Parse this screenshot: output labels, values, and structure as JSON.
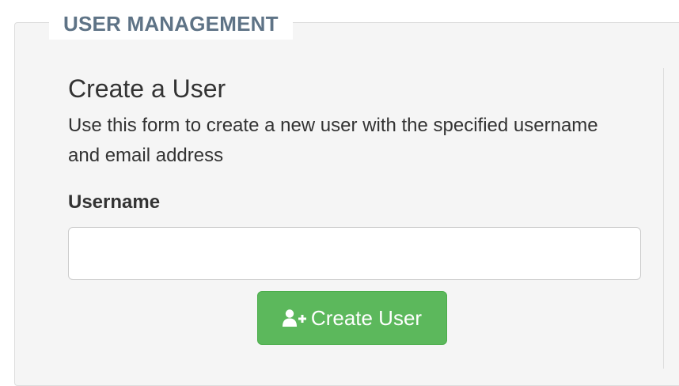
{
  "section": {
    "legend": "USER MANAGEMENT"
  },
  "form": {
    "title": "Create a User",
    "description": "Use this form to create a new user with the specified username and email address",
    "username_label": "Username",
    "username_value": "",
    "username_placeholder": "",
    "submit_label": "Create User",
    "submit_icon": "user-plus-icon"
  },
  "colors": {
    "legend_text": "#5e7386",
    "panel_bg": "#f5f5f5",
    "button_success": "#5cb85c"
  }
}
